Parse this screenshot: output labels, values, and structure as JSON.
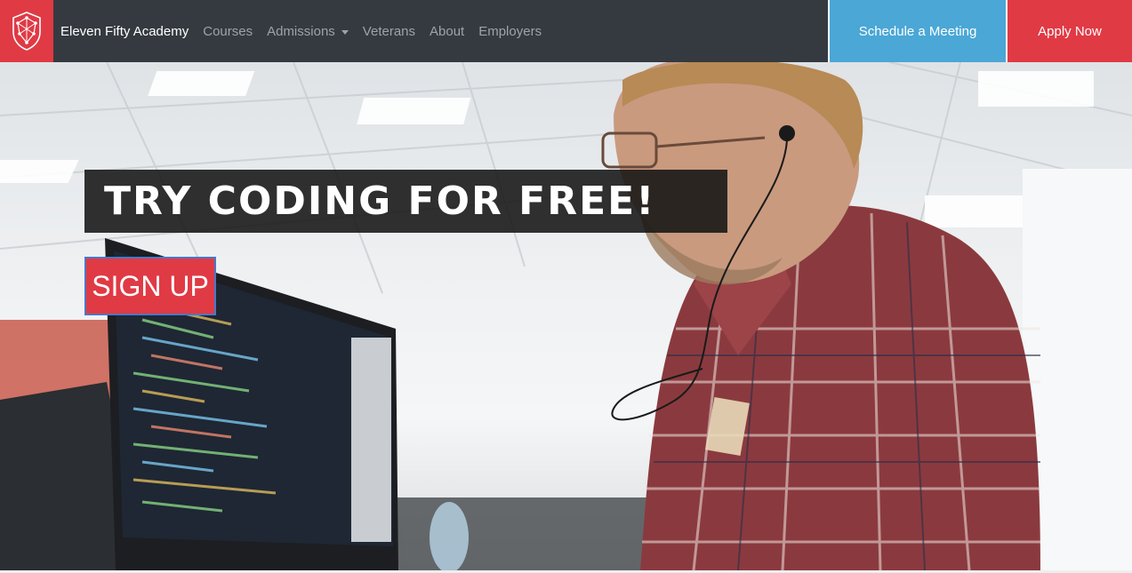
{
  "brand": {
    "name": "Eleven Fifty Academy",
    "logo_icon": "shield-logo-icon",
    "accent_color": "#e03a45"
  },
  "nav": {
    "links": [
      {
        "label": "Courses"
      },
      {
        "label": "Admissions",
        "has_dropdown": true
      },
      {
        "label": "Veterans"
      },
      {
        "label": "About"
      },
      {
        "label": "Employers"
      }
    ],
    "cta": {
      "meeting_label": "Schedule a Meeting",
      "meeting_color": "#4aa7d6",
      "apply_label": "Apply Now",
      "apply_color": "#e03a45"
    }
  },
  "hero": {
    "headline": "TRY CODING FOR FREE!",
    "signup_label": "SIGN UP"
  }
}
